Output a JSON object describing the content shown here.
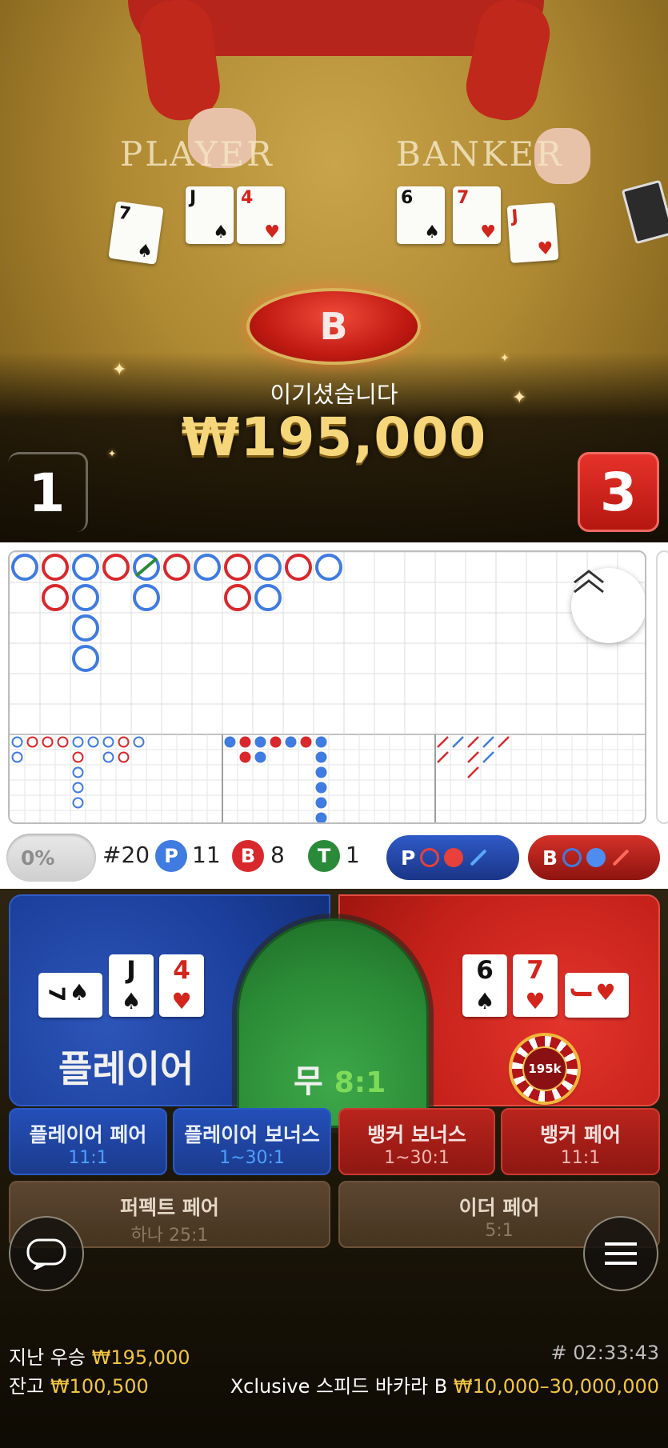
{
  "video": {
    "table_player_word": "PLAYER",
    "table_banker_word": "BANKER",
    "player_cards": [
      {
        "rank": "7",
        "suit": "♠",
        "color": "black"
      },
      {
        "rank": "J",
        "suit": "♠",
        "color": "black"
      },
      {
        "rank": "4",
        "suit": "♥",
        "color": "red"
      }
    ],
    "banker_cards": [
      {
        "rank": "6",
        "suit": "♠",
        "color": "black"
      },
      {
        "rank": "7",
        "suit": "♥",
        "color": "red"
      },
      {
        "rank": "J",
        "suit": "♥",
        "color": "red"
      }
    ],
    "result_badge": "B",
    "win_text": "이기셨습니다",
    "win_amount": "₩195,000",
    "player_score": "1",
    "banker_score": "3"
  },
  "roadmap": {
    "colors": {
      "player": "#3f7be0",
      "banker": "#d9282d",
      "tie": "#2a8a3a"
    },
    "stats": {
      "percent": "0%",
      "round": "#20",
      "player_letter": "P",
      "player_count": "11",
      "banker_letter": "B",
      "banker_count": "8",
      "tie_letter": "T",
      "tie_count": "1"
    },
    "predict_player_label": "P",
    "predict_banker_label": "B"
  },
  "bet": {
    "player_label": "플레이어",
    "tie_label": "무",
    "tie_odds": "8:1",
    "chip_value": "195k",
    "player_cards": [
      {
        "rank": "7",
        "suit": "♠",
        "red": false,
        "side": true
      },
      {
        "rank": "J",
        "suit": "♠",
        "red": false,
        "side": false
      },
      {
        "rank": "4",
        "suit": "♥",
        "red": true,
        "side": false
      }
    ],
    "banker_cards": [
      {
        "rank": "6",
        "suit": "♠",
        "red": false,
        "side": false
      },
      {
        "rank": "7",
        "suit": "♥",
        "red": true,
        "side": false
      },
      {
        "rank": "J",
        "suit": "♥",
        "red": true,
        "side": true
      }
    ],
    "side_bets": [
      {
        "name": "플레이어 페어",
        "odds": "11:1"
      },
      {
        "name": "플레이어 보너스",
        "odds": "1~30:1"
      },
      {
        "name": "뱅커 보너스",
        "odds": "1~30:1"
      },
      {
        "name": "뱅커 페어",
        "odds": "11:1"
      },
      {
        "name": "퍼펙트 페어",
        "odds": "하나 25:1"
      },
      {
        "name": "이더 페어",
        "odds": "5:1"
      }
    ]
  },
  "footer": {
    "last_win_label": "지난 우승",
    "last_win_value": "₩195,000",
    "timestamp": "# 02:33:43",
    "balance_label": "잔고",
    "balance_value": "₩100,500",
    "table_name": "Xclusive 스피드 바카라 B",
    "limits": "₩10,000–30,000,000"
  }
}
